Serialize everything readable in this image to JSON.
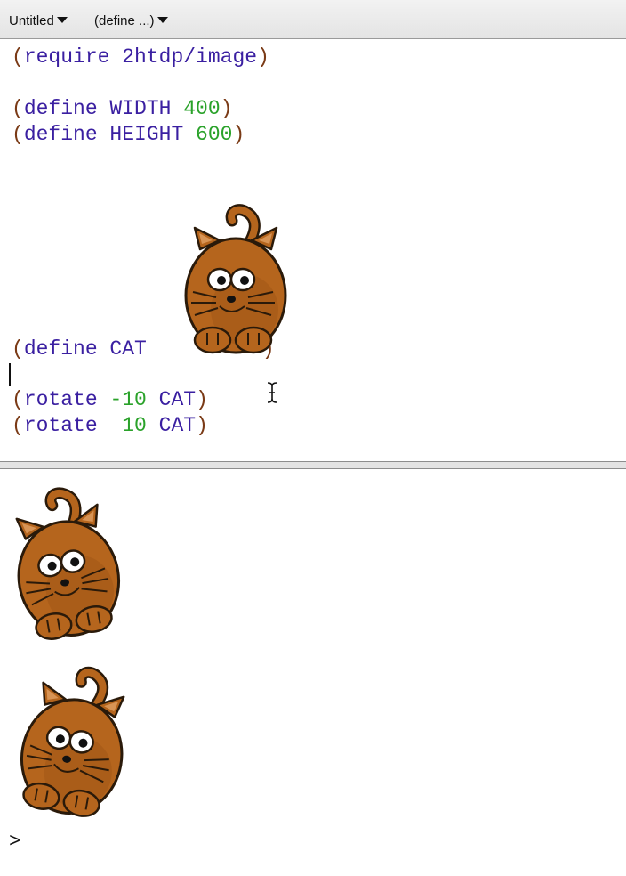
{
  "toolbar": {
    "file_menu": "Untitled",
    "define_menu": "(define ...)"
  },
  "definitions": {
    "lines": [
      {
        "tokens": [
          "(",
          "require 2htdp/image",
          ")"
        ]
      },
      {
        "tokens": [
          "(",
          "define WIDTH ",
          "400",
          ")"
        ]
      },
      {
        "tokens": [
          "(",
          "define HEIGHT ",
          "600",
          ")"
        ]
      },
      {
        "tokens": [
          "(",
          "define CAT",
          ")"
        ]
      },
      {
        "tokens": [
          "(",
          "rotate ",
          "-10",
          " CAT",
          ")"
        ]
      },
      {
        "tokens": [
          "(",
          "rotate  ",
          "10",
          " CAT",
          ")"
        ]
      }
    ],
    "cat_image": "cat-image"
  },
  "interactions": {
    "results": [
      {
        "image": "cat-image",
        "rotation_deg": -10
      },
      {
        "image": "cat-image",
        "rotation_deg": 10
      }
    ],
    "prompt": ">"
  },
  "colors": {
    "keyword": "#3a1fa1",
    "paren": "#7a3a16",
    "number": "#2aa22a",
    "cat_fill": "#b5651d",
    "cat_outline": "#2a1a0a"
  }
}
